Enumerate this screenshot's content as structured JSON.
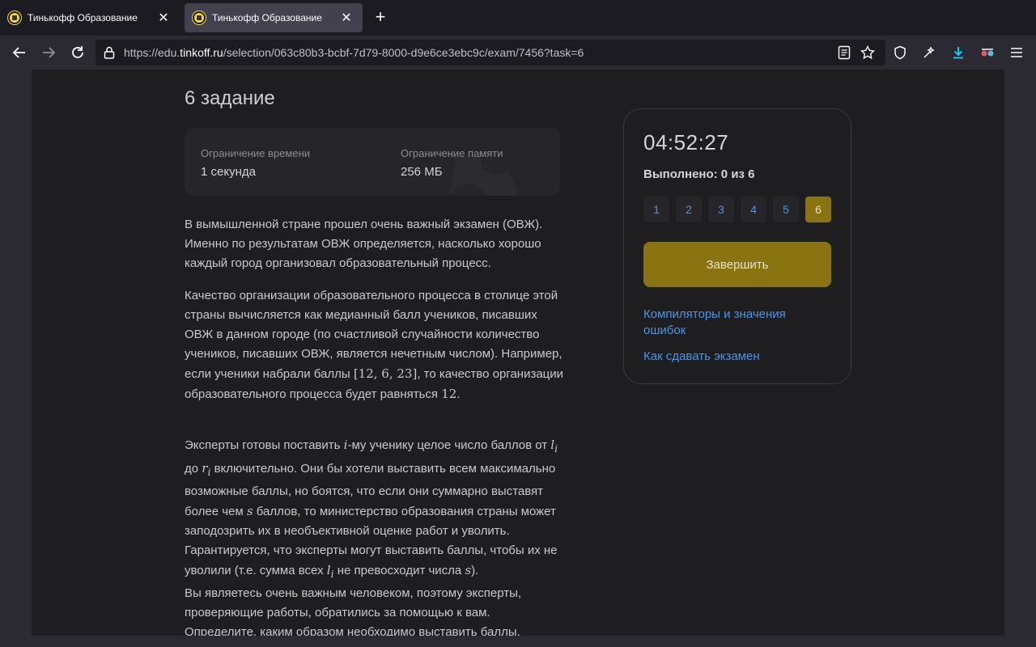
{
  "browser": {
    "tabs": [
      {
        "title": "Тинькофф Образование"
      },
      {
        "title": "Тинькофф Образование"
      }
    ],
    "url_prefix": "https://edu.",
    "url_host": "tinkoff.ru",
    "url_path": "/selection/063c80b3-bcbf-7d79-8000-d9e6ce3ebc9c/exam/7456?task=6"
  },
  "task": {
    "title": "6 задание",
    "time_limit_label": "Ограничение времени",
    "time_limit_value": "1 секунда",
    "memory_limit_label": "Ограничение памяти",
    "memory_limit_value": "256 МБ",
    "p1": "В вымышленной стране прошел очень важный экзамен (ОВЖ). Именно по результатам ОВЖ определяется, насколько хорошо каждый город организовал образовательный процесс.",
    "p2a": "Качество организации образовательного процесса в столице этой страны вычисляется как медианный балл учеников, писавших ОВЖ в данном городе (по счастливой случайности количество учеников, писавших ОВЖ, является нечетным числом). Например, если ученики набрали баллы ",
    "p2_math1": "[12, 6, 23]",
    "p2b": ", то качество организации образовательного процесса будет равняться ",
    "p2_math2": "12",
    "p2c": ".",
    "p3a": "Эксперты готовы поставить ",
    "p3_i": "i",
    "p3b": "-му ученику целое число баллов от ",
    "p3_li": "l",
    "p3c": " до ",
    "p3_ri": "r",
    "p3d": " включительно. Они бы хотели выставить всем максимально возможные баллы, но боятся, что если они суммарно выставят более чем ",
    "p3_s": "s",
    "p3e": " баллов, то министерство образования страны может заподозрить их в необъективной оценке работ и уволить. Гарантируется, что эксперты могут выставить баллы, чтобы их не уволили (т.е. сумма всех ",
    "p3_li2": "l",
    "p3f": " не превосходит числа ",
    "p3_s2": "s",
    "p3g": ").",
    "sub_i": "i",
    "p4": "Вы являетесь очень важным человеком, поэтому эксперты, проверяющие работы, обратились за помощью к вам. Определите, каким образом необходимо выставить баллы."
  },
  "sidebar": {
    "timer": "04:52:27",
    "progress": "Выполнено: 0 из 6",
    "tasks": [
      "1",
      "2",
      "3",
      "4",
      "5",
      "6"
    ],
    "active_task": "6",
    "finish_label": "Завершить",
    "link1": "Компиляторы и значения ошибок",
    "link2": "Как сдавать экзамен"
  }
}
